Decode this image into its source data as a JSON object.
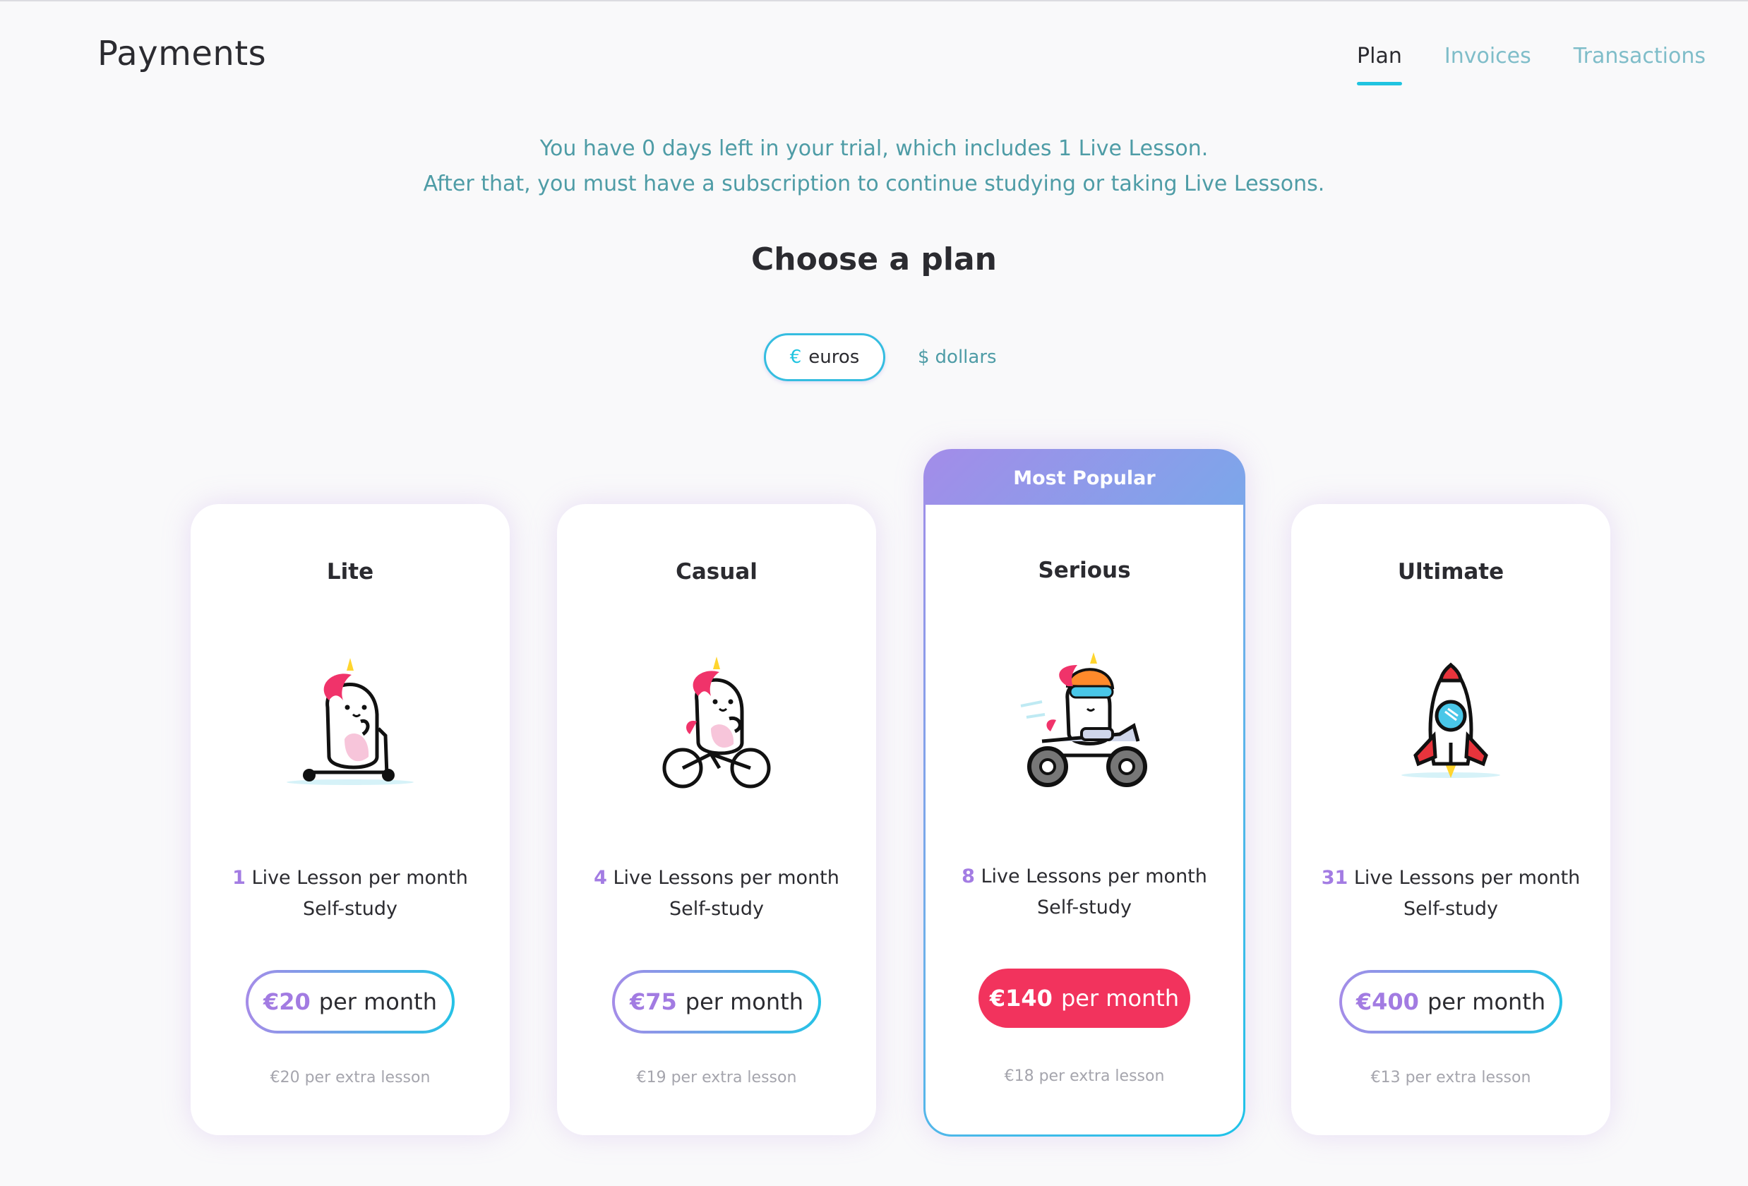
{
  "header": {
    "title": "Payments",
    "tabs": [
      {
        "label": "Plan",
        "active": true
      },
      {
        "label": "Invoices",
        "active": false
      },
      {
        "label": "Transactions",
        "active": false
      }
    ]
  },
  "trial": {
    "line1": "You have 0 days left in your trial, which includes 1 Live Lesson.",
    "line2": "After that, you must have a subscription to continue studying or taking Live Lessons."
  },
  "choose_title": "Choose a plan",
  "currency": {
    "euros": {
      "symbol": "€",
      "label": "euros",
      "selected": true
    },
    "dollars": {
      "symbol": "$",
      "label": "dollars",
      "selected": false
    }
  },
  "plans": [
    {
      "name": "Lite",
      "count": "1",
      "lessons_text": "Live Lesson per month",
      "self_study": "Self-study",
      "price": "€20",
      "per": "per month",
      "extra": "€20 per extra lesson",
      "icon": "unicorn-scooter-icon"
    },
    {
      "name": "Casual",
      "count": "4",
      "lessons_text": "Live Lessons per month",
      "self_study": "Self-study",
      "price": "€75",
      "per": "per month",
      "extra": "€19 per extra lesson",
      "icon": "unicorn-bicycle-icon"
    },
    {
      "name": "Serious",
      "badge": "Most Popular",
      "count": "8",
      "lessons_text": "Live Lessons per month",
      "self_study": "Self-study",
      "price": "€140",
      "per": "per month",
      "extra": "€18 per extra lesson",
      "icon": "unicorn-motorcycle-icon",
      "highlighted": true
    },
    {
      "name": "Ultimate",
      "count": "31",
      "lessons_text": "Live Lessons per month",
      "self_study": "Self-study",
      "price": "€400",
      "per": "per month",
      "extra": "€13 per extra lesson",
      "icon": "rocket-icon"
    }
  ],
  "colors": {
    "accent_teal": "#20c4e0",
    "accent_purple": "#a27be2",
    "cta_pink": "#f2335d",
    "info_text": "#4e9ca6"
  }
}
